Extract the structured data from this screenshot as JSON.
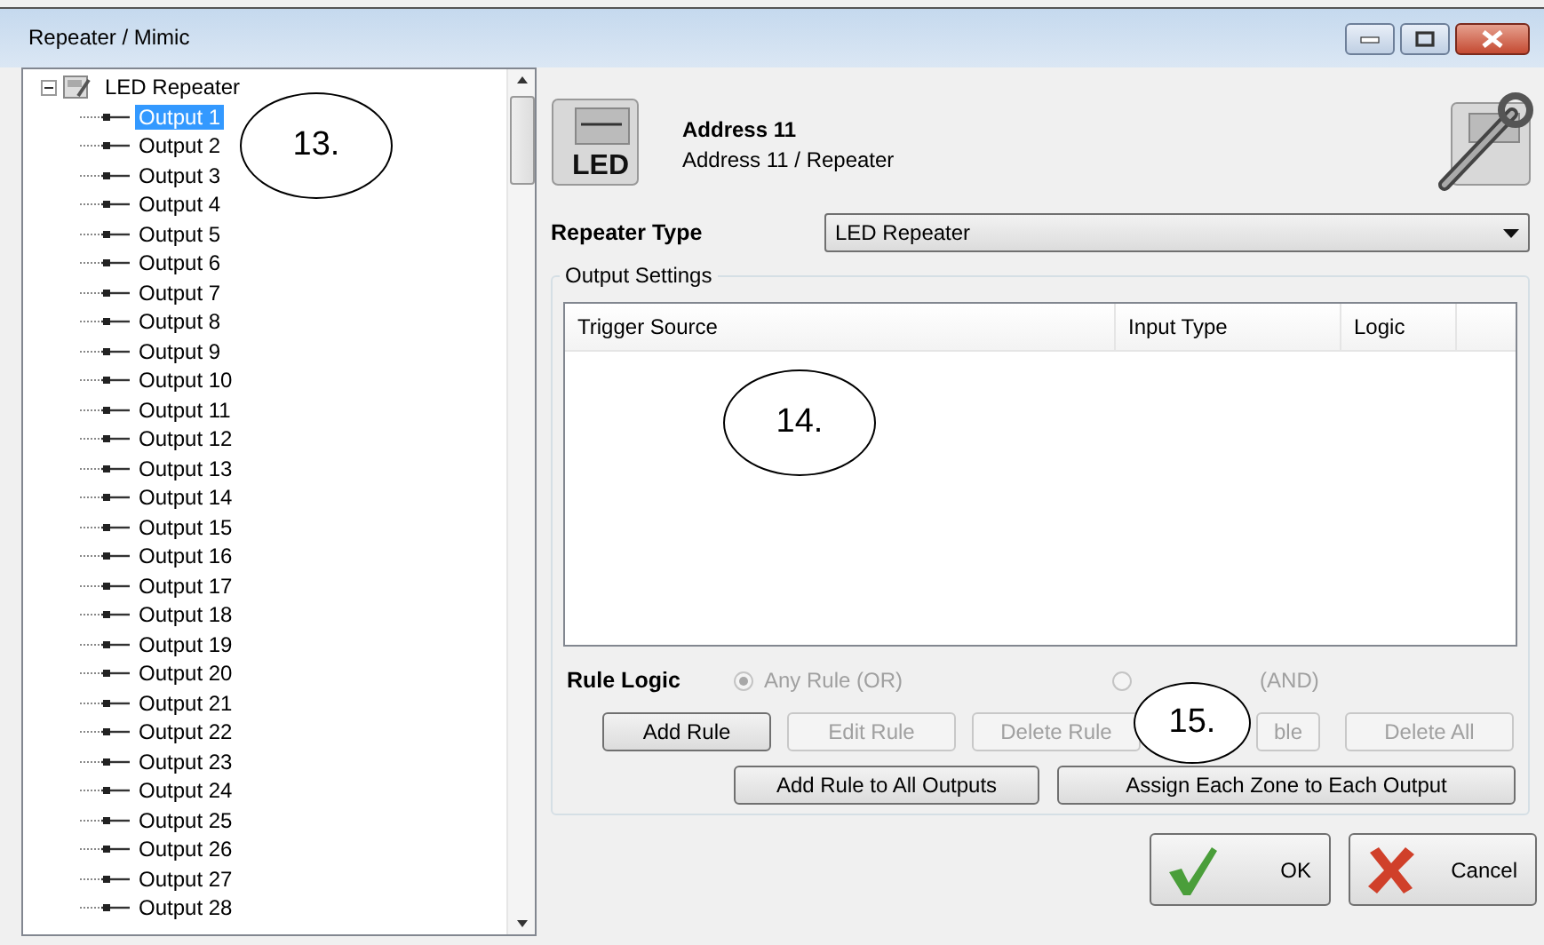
{
  "window": {
    "title": "Repeater / Mimic"
  },
  "tree": {
    "label": "LED Repeater",
    "expanded": true,
    "children": [
      {
        "label": "Output 1",
        "selected": true
      },
      {
        "label": "Output 2",
        "selected": false
      },
      {
        "label": "Output 3",
        "selected": false
      },
      {
        "label": "Output 4",
        "selected": false
      },
      {
        "label": "Output 5",
        "selected": false
      },
      {
        "label": "Output 6",
        "selected": false
      },
      {
        "label": "Output 7",
        "selected": false
      },
      {
        "label": "Output 8",
        "selected": false
      },
      {
        "label": "Output 9",
        "selected": false
      },
      {
        "label": "Output 10",
        "selected": false
      },
      {
        "label": "Output 11",
        "selected": false
      },
      {
        "label": "Output 12",
        "selected": false
      },
      {
        "label": "Output 13",
        "selected": false
      },
      {
        "label": "Output 14",
        "selected": false
      },
      {
        "label": "Output 15",
        "selected": false
      },
      {
        "label": "Output 16",
        "selected": false
      },
      {
        "label": "Output 17",
        "selected": false
      },
      {
        "label": "Output 18",
        "selected": false
      },
      {
        "label": "Output 19",
        "selected": false
      },
      {
        "label": "Output 20",
        "selected": false
      },
      {
        "label": "Output 21",
        "selected": false
      },
      {
        "label": "Output 22",
        "selected": false
      },
      {
        "label": "Output 23",
        "selected": false
      },
      {
        "label": "Output 24",
        "selected": false
      },
      {
        "label": "Output 25",
        "selected": false
      },
      {
        "label": "Output 26",
        "selected": false
      },
      {
        "label": "Output 27",
        "selected": false
      },
      {
        "label": "Output 28",
        "selected": false
      }
    ]
  },
  "device": {
    "badge": "LED",
    "name": "Address 11",
    "path": "Address 11 / Repeater"
  },
  "repeater_type": {
    "label": "Repeater Type",
    "value": "LED Repeater"
  },
  "output_settings": {
    "title": "Output Settings",
    "columns": [
      "Trigger Source",
      "Input Type",
      "Logic"
    ]
  },
  "rule_logic": {
    "label": "Rule Logic",
    "options": [
      {
        "label": "Any Rule (OR)",
        "selected": true,
        "disabled": true
      },
      {
        "label": "(AND)",
        "selected": false,
        "disabled": true
      }
    ]
  },
  "buttons_row1": [
    {
      "label": "Add Rule",
      "disabled": false
    },
    {
      "label": "Edit Rule",
      "disabled": true
    },
    {
      "label": "Delete Rule",
      "disabled": true
    },
    {
      "label": "ble",
      "disabled": true
    },
    {
      "label": "Delete All",
      "disabled": true
    }
  ],
  "buttons_row2": [
    {
      "label": "Add Rule to All Outputs",
      "disabled": false
    },
    {
      "label": "Assign Each Zone to Each Output",
      "disabled": false
    }
  ],
  "dialog_buttons": [
    {
      "kind": "ok",
      "label": "OK"
    },
    {
      "kind": "cancel",
      "label": "Cancel"
    }
  ],
  "callouts": [
    "13.",
    "14.",
    "15."
  ]
}
